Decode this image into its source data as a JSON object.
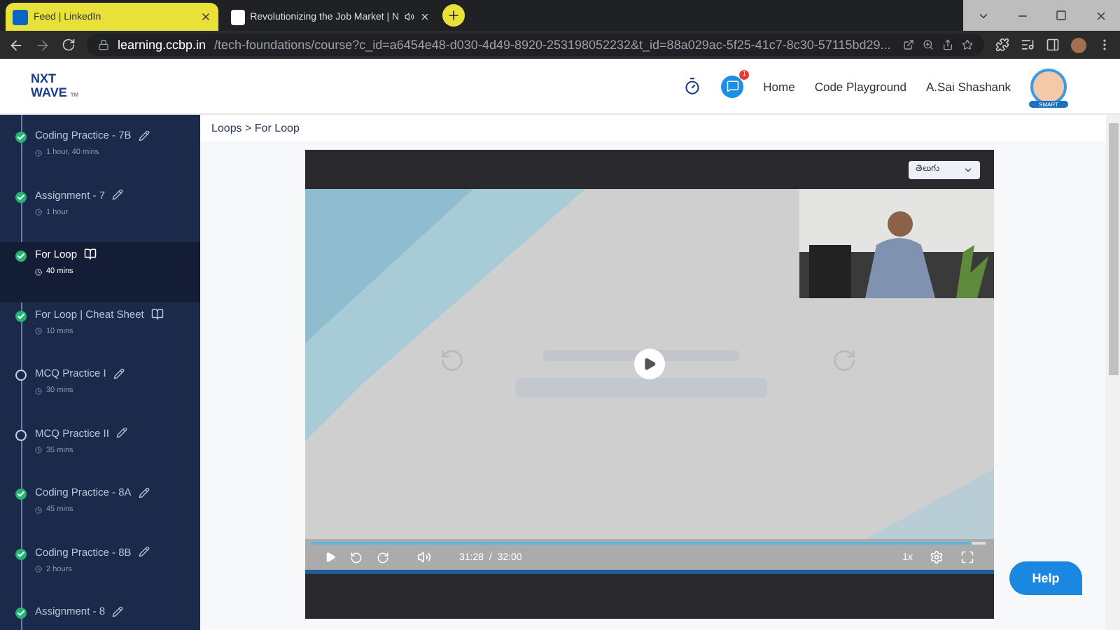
{
  "browser": {
    "tabs": [
      {
        "title": "Feed | LinkedIn",
        "selected": true
      },
      {
        "title": "Revolutionizing the Job Market | N",
        "selected": false
      }
    ],
    "url_host": "learning.ccbp.in",
    "url_path": "/tech-foundations/course?c_id=a6454e48-d030-4d49-8920-253198052232&t_id=88a029ac-5f25-41c7-8c30-57115bd29..."
  },
  "header": {
    "logo_line1": "NXT",
    "logo_line2": "WAVE",
    "logo_tm": "TM",
    "notification_count": "1",
    "nav": [
      "Home",
      "Code Playground"
    ],
    "user": "A.Sai Shashank",
    "avatar_badge": "SMART"
  },
  "sidebar": {
    "items": [
      {
        "title": "Coding Practice - 7B",
        "duration": "1 hour, 40 mins",
        "kind": "practice",
        "completed": true,
        "selected": false
      },
      {
        "title": "Assignment - 7",
        "duration": "1 hour",
        "kind": "practice",
        "completed": true,
        "selected": false
      },
      {
        "title": "For Loop",
        "duration": "40 mins",
        "kind": "reading",
        "completed": true,
        "selected": true
      },
      {
        "title": "For Loop | Cheat Sheet",
        "duration": "10 mins",
        "kind": "reading",
        "completed": true,
        "selected": false
      },
      {
        "title": "MCQ Practice I",
        "duration": "30 mins",
        "kind": "practice",
        "completed": false,
        "selected": false
      },
      {
        "title": "MCQ Practice II",
        "duration": "35 mins",
        "kind": "practice",
        "completed": false,
        "selected": false
      },
      {
        "title": "Coding Practice - 8A",
        "duration": "45 mins",
        "kind": "practice",
        "completed": true,
        "selected": false
      },
      {
        "title": "Coding Practice - 8B",
        "duration": "2 hours",
        "kind": "practice",
        "completed": true,
        "selected": false
      },
      {
        "title": "Assignment - 8",
        "kind": "practice",
        "completed": true,
        "selected": false
      }
    ]
  },
  "breadcrumb": "Loops > For Loop",
  "player": {
    "language": "తెలుగు",
    "current": "31:28",
    "separator": "/",
    "total": "32:00",
    "level": 0.98,
    "speed": "1x"
  },
  "help": "Help"
}
